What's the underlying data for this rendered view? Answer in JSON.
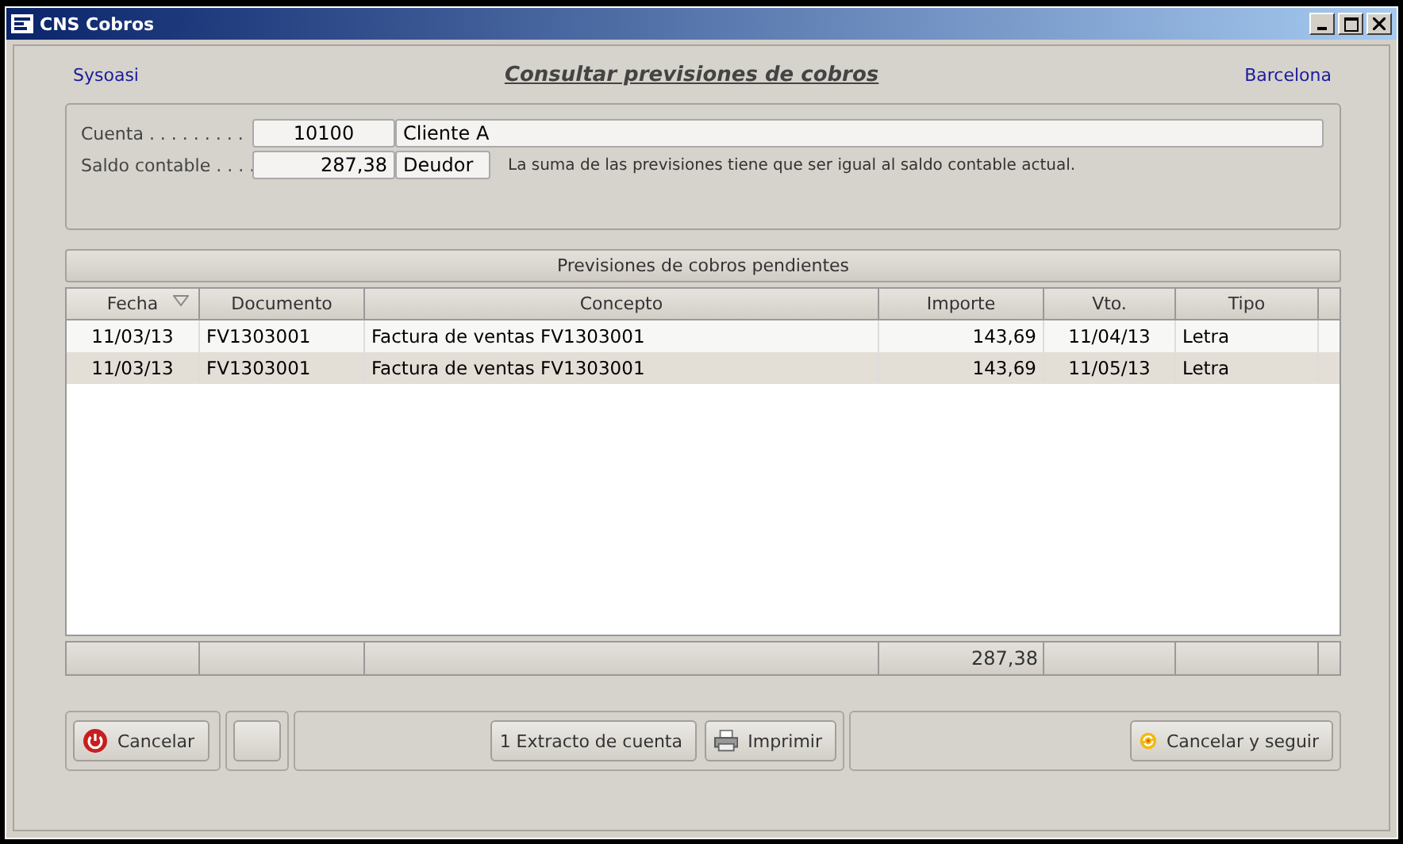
{
  "window": {
    "title": "CNS Cobros"
  },
  "header": {
    "left": "Sysoasi",
    "title": "Consultar previsiones de cobros",
    "right": "Barcelona"
  },
  "account": {
    "cuenta_label": "Cuenta . . . . . . . . .",
    "cuenta_code": "10100",
    "cuenta_name": "Cliente A",
    "saldo_label": "Saldo contable . . . .",
    "saldo_value": "287,38",
    "saldo_type": "Deudor",
    "note": "La suma de las previsiones tiene que ser igual al saldo contable actual."
  },
  "table": {
    "caption": "Previsiones de cobros pendientes",
    "columns": [
      {
        "label": "Fecha",
        "sorted": true
      },
      {
        "label": "Documento",
        "sorted": false
      },
      {
        "label": "Concepto",
        "sorted": false
      },
      {
        "label": "Importe",
        "sorted": false,
        "total": "287,38"
      },
      {
        "label": "Vto.",
        "sorted": false
      },
      {
        "label": "Tipo",
        "sorted": false
      }
    ],
    "rows": [
      [
        "11/03/13",
        "FV1303001",
        "Factura de ventas FV1303001",
        "143,69",
        "11/04/13",
        "Letra"
      ],
      [
        "11/03/13",
        "FV1303001",
        "Factura de ventas FV1303001",
        "143,69",
        "11/05/13",
        "Letra"
      ]
    ]
  },
  "buttons": {
    "cancel": "Cancelar",
    "extract": "1  Extracto de cuenta",
    "print": "Imprimir",
    "cancel_continue": "Cancelar y seguir"
  }
}
